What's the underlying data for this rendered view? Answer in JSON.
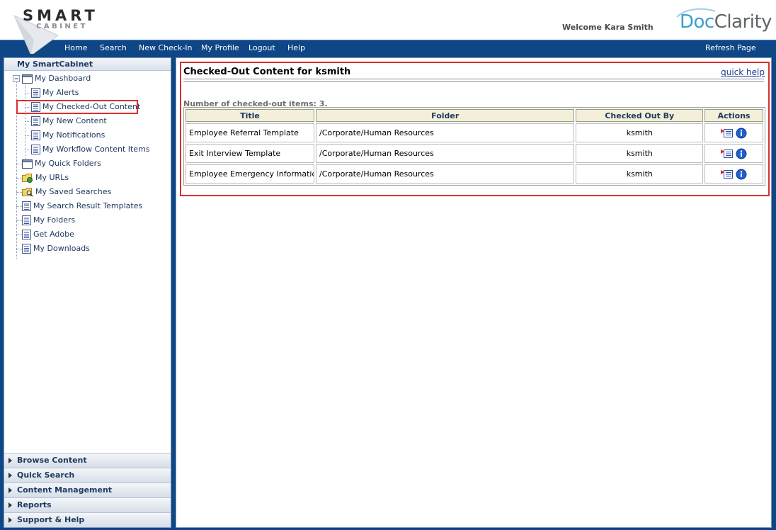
{
  "brand": {
    "logo_line1": "SMART",
    "logo_line2": "CABINET",
    "partner_doc": "Doc",
    "partner_clarity": "Clarity"
  },
  "header": {
    "welcome": "Welcome Kara Smith"
  },
  "nav": {
    "items": [
      "Home",
      "Search",
      "New Check-In",
      "My Profile",
      "Logout",
      "Help"
    ],
    "refresh": "Refresh Page"
  },
  "sidebar": {
    "title": "My SmartCabinet",
    "items": [
      {
        "label": "My Dashboard",
        "icon": "window-icon"
      },
      {
        "label": "My Alerts",
        "icon": "document-icon"
      },
      {
        "label": "My Checked-Out Content",
        "icon": "document-icon"
      },
      {
        "label": "My New Content",
        "icon": "document-icon"
      },
      {
        "label": "My Notifications",
        "icon": "document-icon"
      },
      {
        "label": "My Workflow Content Items",
        "icon": "document-icon"
      },
      {
        "label": "My Quick Folders",
        "icon": "window-icon"
      },
      {
        "label": "My URLs",
        "icon": "folder-globe-icon"
      },
      {
        "label": "My Saved Searches",
        "icon": "folder-search-icon"
      },
      {
        "label": "My Search Result Templates",
        "icon": "document-icon"
      },
      {
        "label": "My Folders",
        "icon": "document-icon"
      },
      {
        "label": "Get Adobe",
        "icon": "document-icon"
      },
      {
        "label": "My Downloads",
        "icon": "document-icon"
      }
    ],
    "sections": [
      "Browse Content",
      "Quick Search",
      "Content Management",
      "Reports",
      "Support & Help"
    ]
  },
  "main": {
    "title": "Checked-Out Content for ksmith",
    "quick_help": "quick help",
    "count_text": "Number of checked-out items: 3.",
    "columns": [
      "Title",
      "Folder",
      "Checked Out By",
      "Actions"
    ],
    "rows": [
      {
        "title": "Employee Referral Template",
        "folder": "/Corporate/Human Resources",
        "by": "ksmith"
      },
      {
        "title": "Exit Interview Template",
        "folder": "/Corporate/Human Resources",
        "by": "ksmith"
      },
      {
        "title": "Employee Emergency Information T",
        "folder": "/Corporate/Human Resources",
        "by": "ksmith"
      }
    ]
  },
  "colors": {
    "nav_bg": "#0e4686",
    "highlight": "#d9302f",
    "header_cell": "#f3efd8"
  }
}
